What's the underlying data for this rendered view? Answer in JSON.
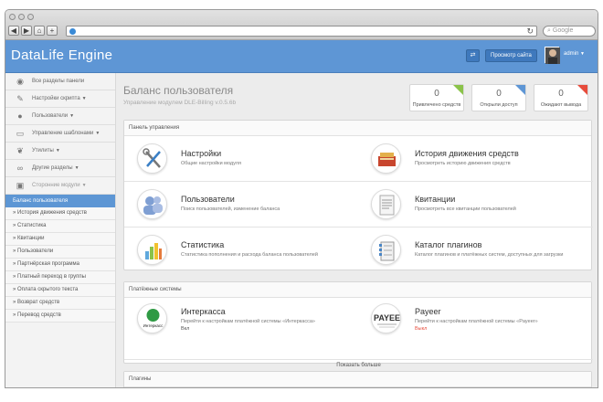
{
  "browser": {
    "nav_buttons": [
      "◀",
      "▶",
      "⌂",
      "+"
    ],
    "search_placeholder": "Google"
  },
  "header": {
    "brand": "DataLife Engine",
    "view_site_label": "Просмотр сайта",
    "user_name": "admin"
  },
  "sidebar": {
    "items": [
      {
        "label": "Все разделы панели",
        "icon": "globe-icon"
      },
      {
        "label": "Настройки скрипта",
        "icon": "wrench-icon",
        "caret": "▼"
      },
      {
        "label": "Пользователи",
        "icon": "user-icon",
        "caret": "▼"
      },
      {
        "label": "Управление шаблонами",
        "icon": "monitor-icon",
        "caret": "▼"
      },
      {
        "label": "Утилиты",
        "icon": "leaf-icon",
        "caret": "▼"
      },
      {
        "label": "Другие разделы",
        "icon": "link-icon",
        "caret": "▼"
      },
      {
        "label": "Сторонние модули",
        "icon": "box-icon",
        "caret": "▼"
      }
    ],
    "active": "Баланс пользователя",
    "subitems": [
      "» История движения средств",
      "» Статистика",
      "» Квитанции",
      "» Пользователи",
      "» Партнёрская программа",
      "» Платный переход в группы",
      "» Оплата скрытого текста",
      "» Возврат средств",
      "» Перевод средств"
    ]
  },
  "page": {
    "title": "Баланс пользователя",
    "subtitle": "Управление модулем DLE-Billing v.0.5.6b"
  },
  "stats": [
    {
      "value": "0",
      "label": "Привлечено средств",
      "color": "#8bc34a"
    },
    {
      "value": "0",
      "label": "Открыли доступ",
      "color": "#5e96d5"
    },
    {
      "value": "0",
      "label": "Ожидают вывода",
      "color": "#e74c3c"
    }
  ],
  "control_panel": {
    "header": "Панель управления",
    "items": [
      {
        "title": "Настройки",
        "desc": "Общие настройки модуля",
        "icon": "tools-icon"
      },
      {
        "title": "История движения средств",
        "desc": "Просмотреть историю движения средств",
        "icon": "cash-register-icon"
      },
      {
        "title": "Пользователи",
        "desc": "Поиск пользователей, изменение баланса",
        "icon": "users-icon"
      },
      {
        "title": "Квитанции",
        "desc": "Просмотреть все квитанции пользователей",
        "icon": "receipt-icon"
      },
      {
        "title": "Статистика",
        "desc": "Статистика пополнения и расхода баланса пользователей",
        "icon": "bar-chart-icon"
      },
      {
        "title": "Каталог плагинов",
        "desc": "Каталог плагинов и платёжных систем, доступных для загрузки",
        "icon": "catalog-icon"
      }
    ]
  },
  "payment_systems": {
    "header": "Платёжные системы",
    "items": [
      {
        "title": "Интеркасса",
        "desc": "Перейти к настройкам платёжной системы «Интеркасса»",
        "status": "Вкл",
        "status_color": "#555555",
        "logo": "Интеркасс"
      },
      {
        "title": "Payeer",
        "desc": "Перейти к настройкам платёжной системы «Payeer»",
        "status": "Выкл",
        "status_color": "#e74c3c",
        "logo": "PAYEE"
      }
    ],
    "more_label": "Показать больше"
  },
  "plugins": {
    "header": "Плагины"
  }
}
